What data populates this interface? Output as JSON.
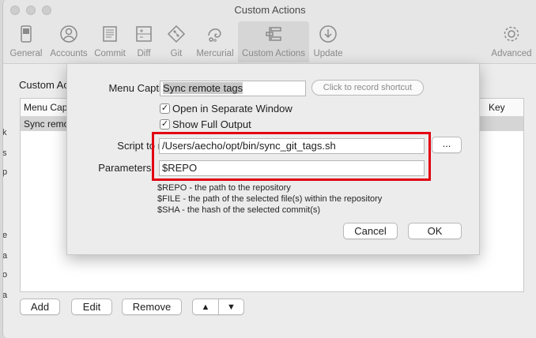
{
  "window": {
    "title": "Custom Actions"
  },
  "toolbar": {
    "items": [
      {
        "label": "General",
        "icon": "general-switch-icon"
      },
      {
        "label": "Accounts",
        "icon": "accounts-person-icon"
      },
      {
        "label": "Commit",
        "icon": "commit-document-icon"
      },
      {
        "label": "Diff",
        "icon": "diff-icon"
      },
      {
        "label": "Git",
        "icon": "git-diamond-icon"
      },
      {
        "label": "Mercurial",
        "icon": "mercurial-icon"
      },
      {
        "label": "Custom Actions",
        "icon": "custom-actions-icon",
        "active": true
      },
      {
        "label": "Update",
        "icon": "update-download-icon"
      },
      {
        "label": "Advanced",
        "icon": "advanced-gear-icon"
      }
    ]
  },
  "background": {
    "heading": "Custom Ac",
    "table": {
      "col_caption": "Menu Capt",
      "col_key": "Key",
      "selected_row": "Sync remo"
    },
    "buttons": {
      "add": "Add",
      "edit": "Edit",
      "remove": "Remove",
      "up": "▲",
      "down": "▼"
    }
  },
  "dialog": {
    "menu_caption_label": "Menu Caption:",
    "menu_caption_value": "Sync remote tags",
    "shortcut_placeholder": "Click to record shortcut",
    "open_separate_window": {
      "label": "Open in Separate Window",
      "checked": true
    },
    "show_full_output": {
      "label": "Show Full Output",
      "checked": true
    },
    "script_label": "Script to run:",
    "script_value": "/Users/aecho/opt/bin/sync_git_tags.sh",
    "browse_button": "...",
    "parameters_label": "Parameters:",
    "parameters_value": "$REPO",
    "help_lines": [
      "$REPO - the path to the repository",
      "$FILE - the path of the selected file(s) within the repository",
      "$SHA - the hash of the selected commit(s)"
    ],
    "cancel_button": "Cancel",
    "ok_button": "OK"
  },
  "colors": {
    "highlight_box": "#e20012",
    "selection": "#d5d5d5"
  }
}
